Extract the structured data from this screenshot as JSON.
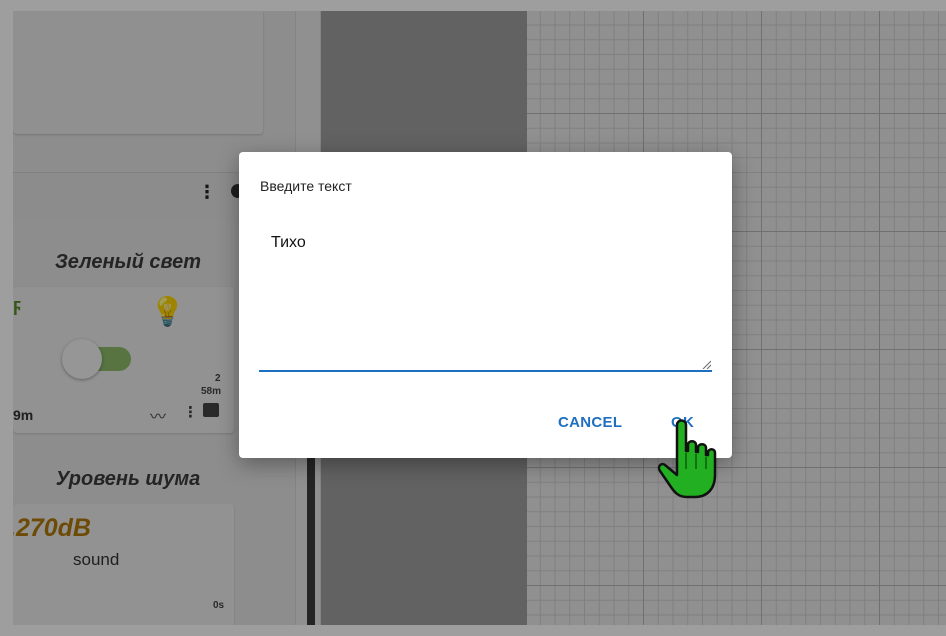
{
  "widgets": {
    "light": {
      "title": "Зеленый свет",
      "stat_count": "2",
      "stat_time": "58m",
      "time_left": "9m"
    },
    "noise": {
      "title": "Уровень шума",
      "value": ".270dB",
      "label": "sound",
      "stat_time": "0s"
    }
  },
  "dialog": {
    "title": "Введите текст",
    "text_value": "Тихо",
    "cancel_label": "CANCEL",
    "ok_label": "OK"
  },
  "colors": {
    "accent": "#1e6fc0",
    "toggle_on": "#8dbb6a",
    "sound_value": "#b07a0a",
    "cursor_green": "#22b022"
  },
  "icons": [
    "menu-dots-icon",
    "bolt-icon",
    "bulb-icon",
    "chart-icon",
    "image-add-icon",
    "hand-pointer-icon"
  ]
}
